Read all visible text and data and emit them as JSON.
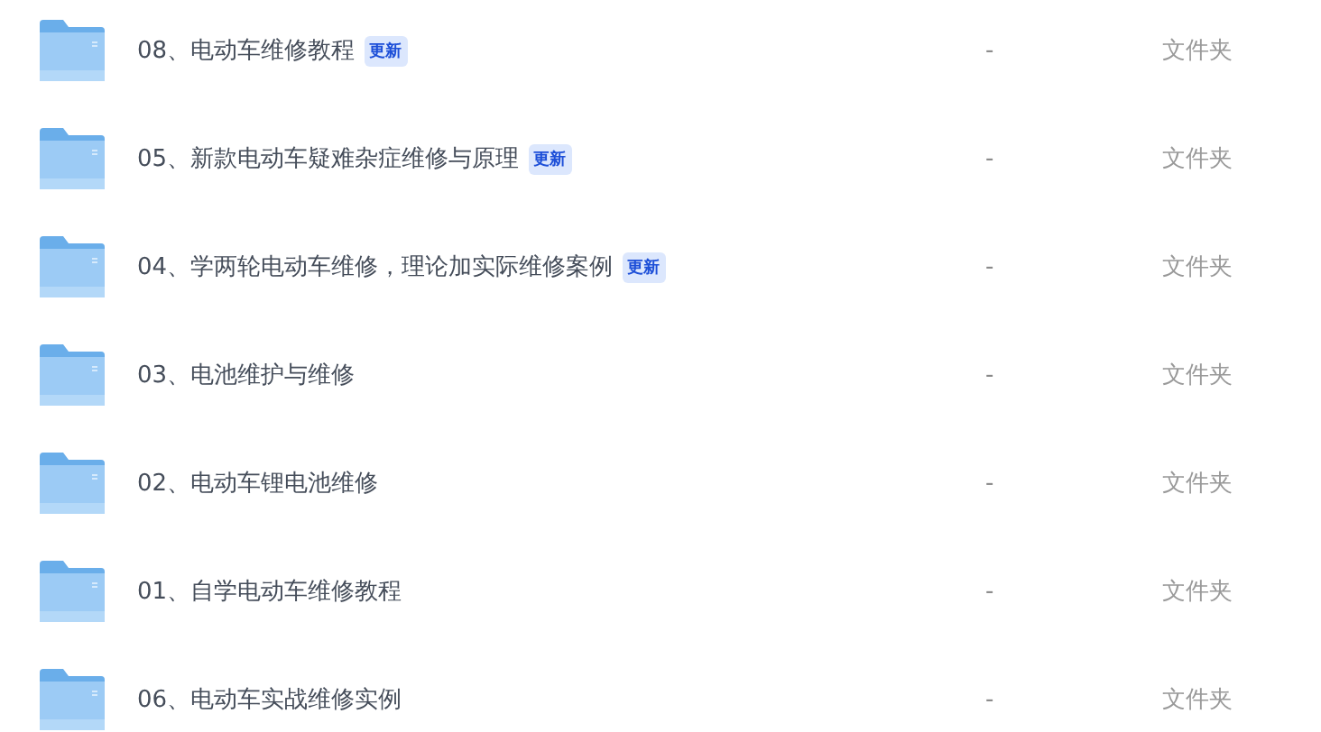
{
  "files": [
    {
      "name": "08、电动车维修教程",
      "badge": "更新",
      "size": "-",
      "type": "文件夹"
    },
    {
      "name": "05、新款电动车疑难杂症维修与原理",
      "badge": "更新",
      "size": "-",
      "type": "文件夹"
    },
    {
      "name": "04、学两轮电动车维修，理论加实际维修案例",
      "badge": "更新",
      "size": "-",
      "type": "文件夹"
    },
    {
      "name": "03、电池维护与维修",
      "size": "-",
      "type": "文件夹"
    },
    {
      "name": "02、电动车锂电池维修",
      "size": "-",
      "type": "文件夹"
    },
    {
      "name": "01、自学电动车维修教程",
      "size": "-",
      "type": "文件夹"
    },
    {
      "name": "06、电动车实战维修实例",
      "size": "-",
      "type": "文件夹"
    }
  ]
}
